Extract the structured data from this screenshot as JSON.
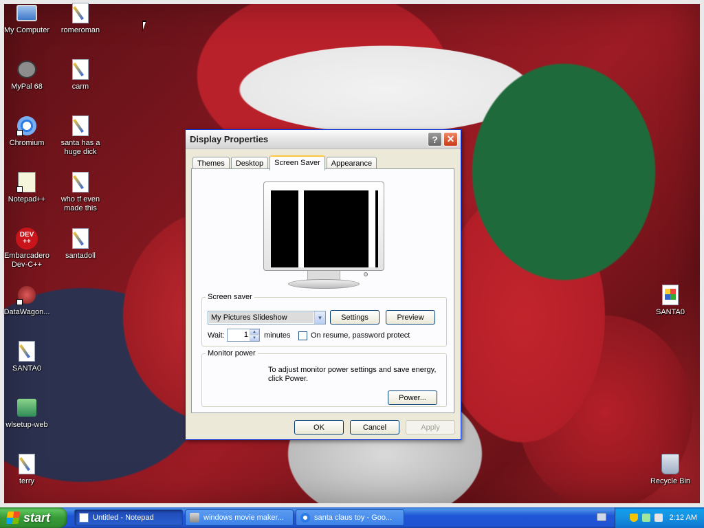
{
  "desktop": {
    "icons": [
      {
        "label": "My Computer",
        "icon": "computer-icon"
      },
      {
        "label": "romeroman",
        "icon": "paint-doc-icon"
      },
      {
        "label": "MyPal 68",
        "icon": "raccoon-icon"
      },
      {
        "label": "carm",
        "icon": "paint-doc-icon"
      },
      {
        "label": "Chromium",
        "icon": "chromium-icon"
      },
      {
        "label": "santa has a huge dick",
        "icon": "paint-doc-icon"
      },
      {
        "label": "Notepad++",
        "icon": "notepadpp-icon"
      },
      {
        "label": "who tf even made this",
        "icon": "paint-doc-icon"
      },
      {
        "label": "Embarcadero Dev-C++",
        "icon": "devcpp-icon",
        "glyph_text": "DEV\n++"
      },
      {
        "label": "santadoll",
        "icon": "paint-doc-icon"
      },
      {
        "label": "DataWagon...",
        "icon": "datawagon-icon"
      },
      {
        "label": "SANTA0",
        "icon": "paint-doc-icon"
      },
      {
        "label": "wlsetup-web",
        "icon": "setup-icon"
      },
      {
        "label": "terry",
        "icon": "paint-doc-icon"
      },
      {
        "label": "SANTA0",
        "icon": "image-doc-icon"
      },
      {
        "label": "Recycle Bin",
        "icon": "recycle-bin-icon"
      }
    ]
  },
  "dialog": {
    "title": "Display Properties",
    "help_label": "?",
    "close_label": "✕",
    "tabs": [
      {
        "label": "Themes",
        "active": false
      },
      {
        "label": "Desktop",
        "active": false
      },
      {
        "label": "Screen Saver",
        "active": true
      },
      {
        "label": "Appearance",
        "active": false
      }
    ],
    "screen_saver": {
      "group_label": "Screen saver",
      "selected": "My Pictures Slideshow",
      "settings_label": "Settings",
      "preview_label": "Preview",
      "wait_label": "Wait:",
      "wait_value": "1",
      "minutes_label": "minutes",
      "password_label": "On resume, password protect",
      "password_checked": false
    },
    "monitor_power": {
      "group_label": "Monitor power",
      "text": "To adjust monitor power settings and save energy, click Power.",
      "power_label": "Power..."
    },
    "buttons": {
      "ok": "OK",
      "cancel": "Cancel",
      "apply": "Apply"
    }
  },
  "taskbar": {
    "start_label": "start",
    "tasks": [
      {
        "label": "Untitled - Notepad",
        "active": true
      },
      {
        "label": "windows movie maker...",
        "active": false
      },
      {
        "label": "santa claus toy - Goo...",
        "active": false
      }
    ],
    "clock": "2:12 AM"
  },
  "colors": {
    "title_active": "#0831d9",
    "taskbar_blue": "#2157d7",
    "start_green": "#379b37",
    "dialog_face": "#ece9d8"
  }
}
